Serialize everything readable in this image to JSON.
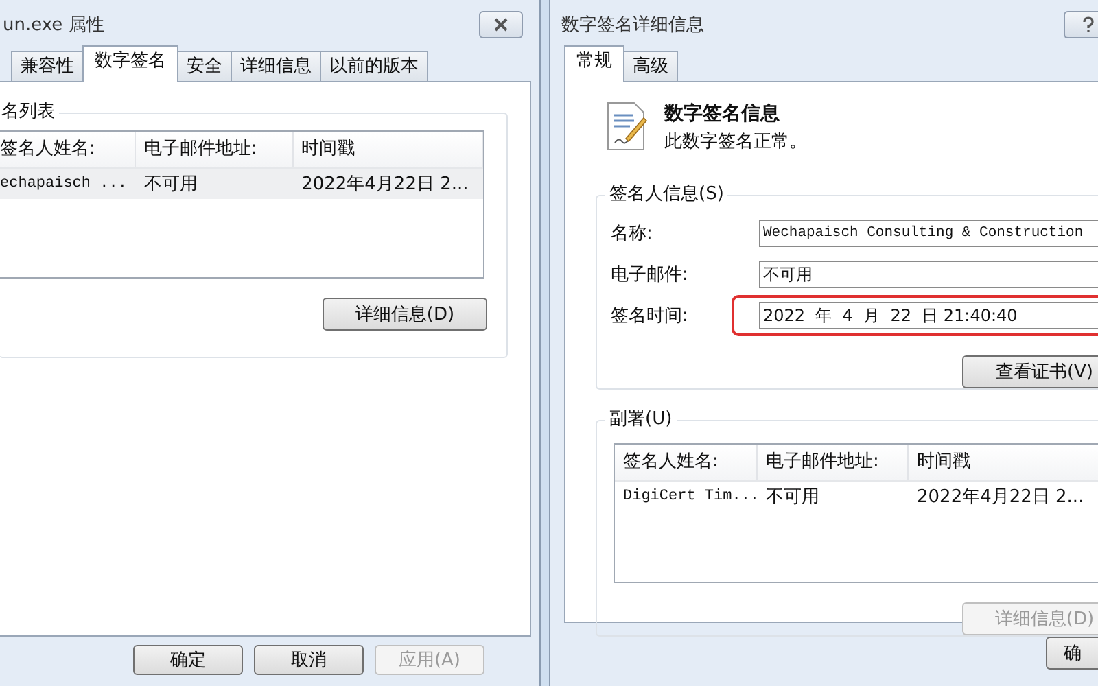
{
  "left_window": {
    "title": "un.exe 属性",
    "tabs": [
      {
        "label": "兼容性",
        "selected": false
      },
      {
        "label": "数字签名",
        "selected": true
      },
      {
        "label": "安全",
        "selected": false
      },
      {
        "label": "详细信息",
        "selected": false
      },
      {
        "label": "以前的版本",
        "selected": false
      }
    ],
    "group_label": "名列表",
    "list": {
      "columns": [
        "签名人姓名:",
        "电子邮件地址:",
        "时间戳"
      ],
      "rows": [
        {
          "cells": [
            "echapaisch ...",
            "不可用",
            "2022年4月22日 2..."
          ],
          "selected": true
        }
      ]
    },
    "details_button": {
      "label": "详细信息(D)",
      "disabled": false
    },
    "buttons": [
      {
        "label": "确定",
        "disabled": false
      },
      {
        "label": "取消",
        "disabled": false
      },
      {
        "label": "应用(A)",
        "disabled": true
      }
    ]
  },
  "right_window": {
    "title": "数字签名详细信息",
    "tabs": [
      {
        "label": "常规",
        "selected": true
      },
      {
        "label": "高级",
        "selected": false
      }
    ],
    "info_heading": "数字签名信息",
    "info_status": "此数字签名正常。",
    "signer_group_label": "签名人信息(S)",
    "fields": [
      {
        "label": "名称:",
        "value": "Wechapaisch Consulting & Construction",
        "highlighted": false
      },
      {
        "label": "电子邮件:",
        "value": "不可用",
        "highlighted": false
      },
      {
        "label": "签名时间:",
        "value": "2022  年  4  月  22  日 21:40:40",
        "highlighted": true
      }
    ],
    "view_cert_button": {
      "label": "查看证书(V)",
      "disabled": false
    },
    "countersign_group_label": "副署(U)",
    "list": {
      "columns": [
        "签名人姓名:",
        "电子邮件地址:",
        "时间戳"
      ],
      "rows": [
        {
          "cells": [
            "DigiCert Tim...",
            "不可用",
            "2022年4月22日 2..."
          ],
          "selected": false
        }
      ]
    },
    "details_button": {
      "label": "详细信息(D)",
      "disabled": true
    },
    "ok_button": {
      "label": "确",
      "disabled": false
    }
  }
}
